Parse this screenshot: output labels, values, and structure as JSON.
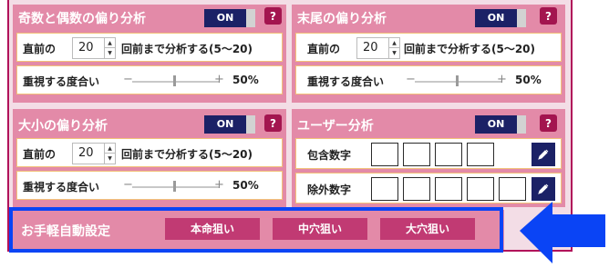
{
  "panels": [
    {
      "title": "奇数と偶数の偏り分析",
      "toggle": "ON",
      "row1": {
        "label": "直前の",
        "value": "20",
        "suffix": "回前まで分析する(5〜20)"
      },
      "row2": {
        "label": "重視する度合い",
        "minus": "−",
        "plus": "+",
        "percent": "50%"
      }
    },
    {
      "title": "末尾の偏り分析",
      "toggle": "ON",
      "row1": {
        "label": "直前の",
        "value": "20",
        "suffix": "回前まで分析する(5〜20)"
      },
      "row2": {
        "label": "重視する度合い",
        "minus": "−",
        "plus": "+",
        "percent": "50%"
      }
    },
    {
      "title": "大小の偏り分析",
      "toggle": "ON",
      "row1": {
        "label": "直前の",
        "value": "20",
        "suffix": "回前まで分析する(5〜20)"
      },
      "row2": {
        "label": "重視する度合い",
        "minus": "−",
        "plus": "+",
        "percent": "50%"
      }
    },
    {
      "title": "ユーザー分析",
      "toggle": "ON",
      "row1": {
        "label": "包含数字"
      },
      "row2": {
        "label": "除外数字"
      }
    }
  ],
  "quick": {
    "label": "お手軽自動設定",
    "buttons": [
      "本命狙い",
      "中穴狙い",
      "大穴狙い"
    ]
  },
  "help_glyph": "?",
  "colors": {
    "panel": "#e38aa8",
    "toggle": "#1b2166",
    "accent": "#b1125a",
    "highlight": "#0a44f5"
  }
}
